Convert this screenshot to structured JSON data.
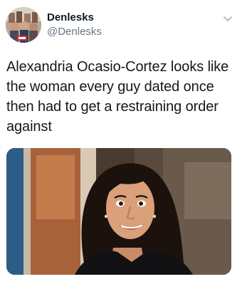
{
  "tweet": {
    "author": {
      "display_name": "Denlesks",
      "handle": "@Denlesks",
      "avatar_icon": "avatar-photo"
    },
    "menu_icon": "chevron-down-icon",
    "text": "Alexandria Ocasio-Cortez looks like the woman every guy dated once then had to get a restraining order against",
    "media": {
      "type": "photo"
    }
  },
  "colors": {
    "text": "#14171a",
    "secondary": "#657786",
    "chevron": "#aab8c2"
  }
}
